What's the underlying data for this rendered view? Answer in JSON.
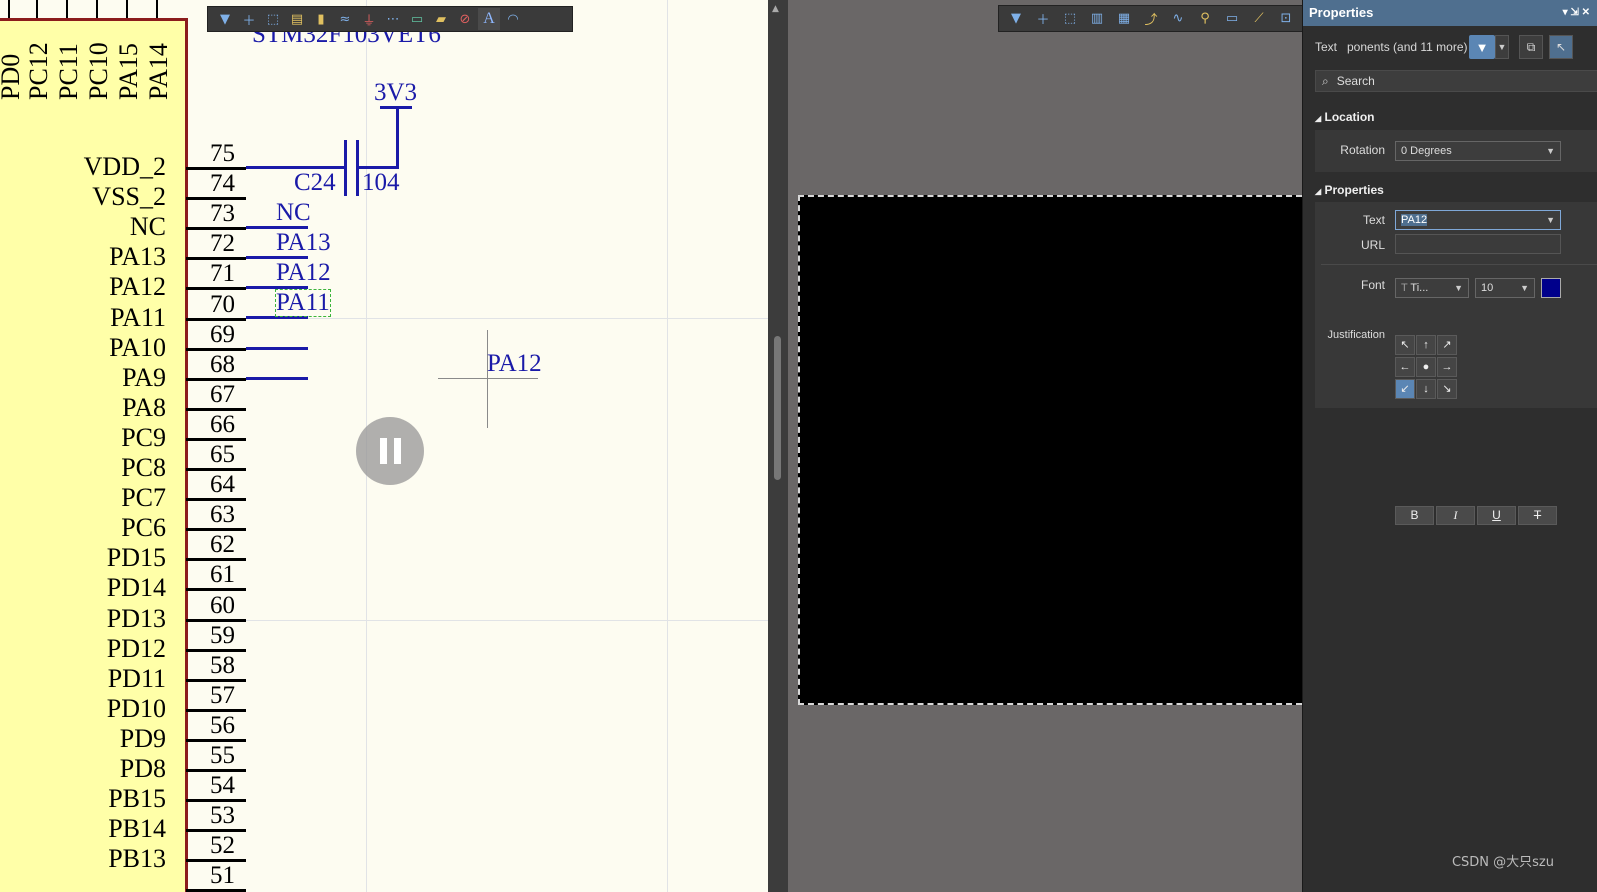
{
  "schematic": {
    "part_label": "STM32F103VET6",
    "top_pins": [
      "PD0",
      "PC12",
      "PC11",
      "PC10",
      "PA15",
      "PA14"
    ],
    "left_pins": [
      {
        "name": "VDD_2",
        "num": "75"
      },
      {
        "name": "VSS_2",
        "num": "74"
      },
      {
        "name": "NC",
        "num": "73"
      },
      {
        "name": "PA13",
        "num": "72"
      },
      {
        "name": "PA12",
        "num": "71"
      },
      {
        "name": "PA11",
        "num": "70"
      },
      {
        "name": "PA10",
        "num": "69"
      },
      {
        "name": "PA9",
        "num": "68"
      },
      {
        "name": "PA8",
        "num": "67"
      },
      {
        "name": "PC9",
        "num": "66"
      },
      {
        "name": "PC8",
        "num": "65"
      },
      {
        "name": "PC7",
        "num": "64"
      },
      {
        "name": "PC6",
        "num": "63"
      },
      {
        "name": "PD15",
        "num": "62"
      },
      {
        "name": "PD14",
        "num": "61"
      },
      {
        "name": "PD13",
        "num": "60"
      },
      {
        "name": "PD12",
        "num": "59"
      },
      {
        "name": "PD11",
        "num": "58"
      },
      {
        "name": "PD10",
        "num": "57"
      },
      {
        "name": "PD9",
        "num": "56"
      },
      {
        "name": "PD8",
        "num": "55"
      },
      {
        "name": "PB15",
        "num": "54"
      },
      {
        "name": "PB14",
        "num": "53"
      },
      {
        "name": "PB13",
        "num": "52"
      },
      {
        "name": "",
        "num": "51"
      }
    ],
    "power_label": "3V3",
    "cap_ref": "C24",
    "cap_value": "104",
    "net_labels": [
      "NC",
      "PA13",
      "PA12",
      "PA11"
    ],
    "floating_label": "PA12"
  },
  "properties": {
    "title": "Properties",
    "header_controls": "▾ ⇲ ✕",
    "filter_kind": "Text",
    "filter_scope": "ponents (and 11 more)",
    "search_placeholder": "Search",
    "location_section": "Location",
    "rotation_label": "Rotation",
    "rotation_value": "0 Degrees",
    "properties_section": "Properties",
    "text_label": "Text",
    "text_value": "PA12",
    "url_label": "URL",
    "url_value": "",
    "font_label": "Font",
    "font_family": "Ti...",
    "font_size": "10",
    "font_color": "#00008b",
    "bold": "B",
    "italic": "I",
    "underline": "U",
    "strike": "T",
    "justification_label": "Justification",
    "justification_glyphs": [
      "↖",
      "↑",
      "↗",
      "←",
      "●",
      "→",
      "↙",
      "↓",
      "↘"
    ]
  },
  "watermark": "CSDN @大只szu"
}
